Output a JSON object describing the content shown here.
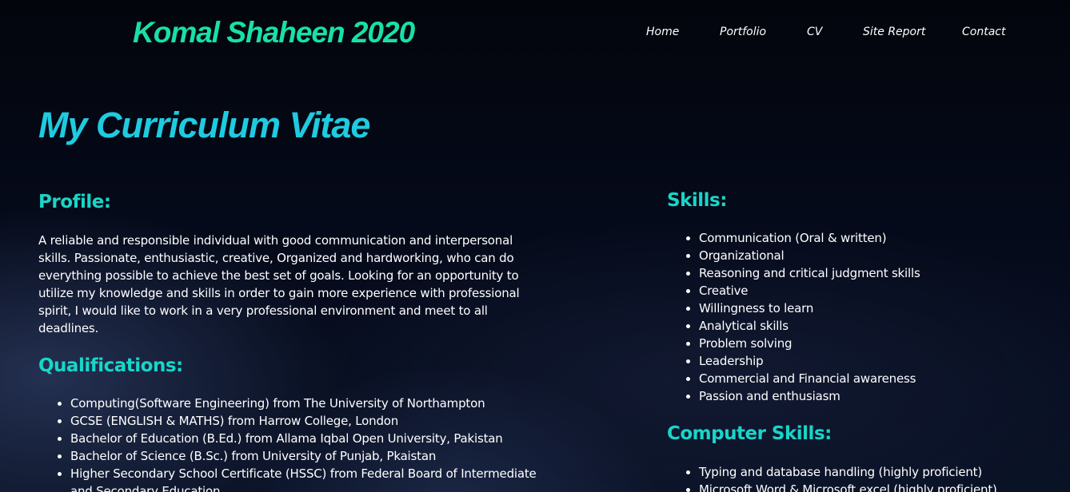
{
  "header": {
    "site_title": "Komal Shaheen 2020",
    "nav": [
      "Home",
      "Portfolio",
      "CV",
      "Site Report",
      "Contact"
    ]
  },
  "main": {
    "page_title": "My Curriculum Vitae",
    "profile": {
      "heading": "Profile:",
      "text": "A reliable and responsible individual with good communication and interpersonal skills. Passionate, enthusiastic, creative, Organized and hardworking, who can do everything possible to achieve the best set of goals. Looking for an opportunity to utilize my knowledge and skills in order to gain more experience with professional spirit, I would like to work in a very professional environment and meet to all deadlines."
    },
    "qualifications": {
      "heading": "Qualifications:",
      "items": [
        "Computing(Software Engineering) from The University of Northampton",
        "GCSE (ENGLISH & MATHS) from Harrow College, London",
        "Bachelor of Education (B.Ed.) from Allama Iqbal Open University, Pakistan",
        "Bachelor of Science (B.Sc.) from University of Punjab, Pkaistan",
        "Higher Secondary School Certificate (HSSC) from Federal Board of Intermediate and Secondary Education"
      ]
    },
    "skills": {
      "heading": "Skills:",
      "items": [
        "Communication (Oral & written)",
        "Organizational",
        "Reasoning and critical judgment skills",
        "Creative",
        "Willingness to learn",
        "Analytical skills",
        "Problem solving",
        "Leadership",
        "Commercial and Financial awareness",
        "Passion and enthusiasm"
      ]
    },
    "computer_skills": {
      "heading": "Computer Skills:",
      "items": [
        "Typing and database handling (highly proficient)",
        "Microsoft Word & Microsoft excel (highly proficient)"
      ]
    }
  },
  "colors": {
    "site_title": "#18e0a6",
    "page_title": "#1ecbe0",
    "section_heading": "#18d6c8",
    "background": "#050a1a"
  }
}
